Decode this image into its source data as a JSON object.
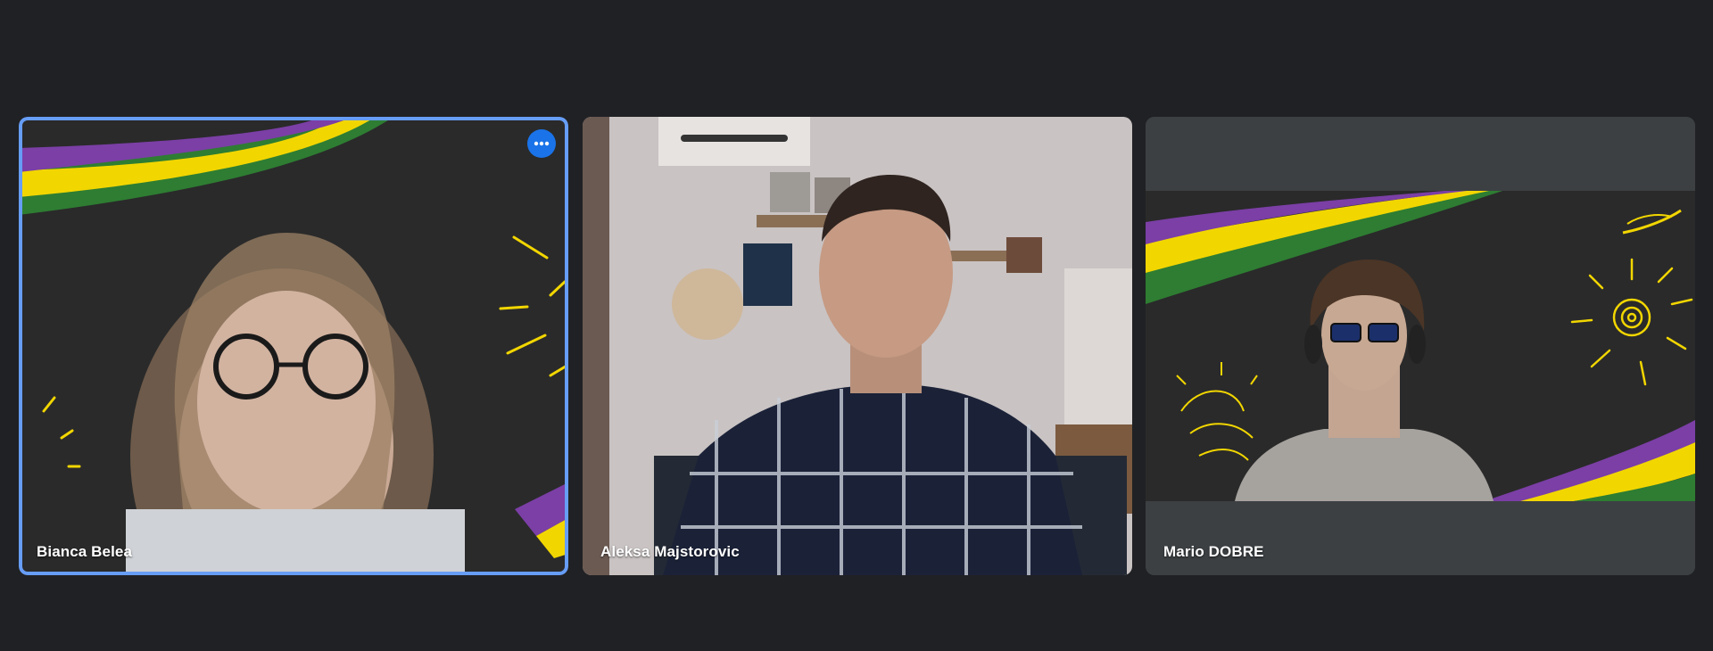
{
  "meeting": {
    "participants": [
      {
        "name": "Bianca Belea",
        "active_speaker": true,
        "options_icon": "more-horiz-icon"
      },
      {
        "name": "Aleksa Majstorovic",
        "active_speaker": false
      },
      {
        "name": "Mario DOBRE",
        "active_speaker": false
      }
    ]
  },
  "colors": {
    "page_background": "#202124",
    "tile_background": "#3c4043",
    "active_border": "#669df6",
    "options_button": "#1a73e8",
    "banner_purple": "#7b3fa6",
    "banner_yellow": "#f2d600",
    "banner_green": "#2e7d32",
    "chalkboard": "#2b2b2b"
  }
}
